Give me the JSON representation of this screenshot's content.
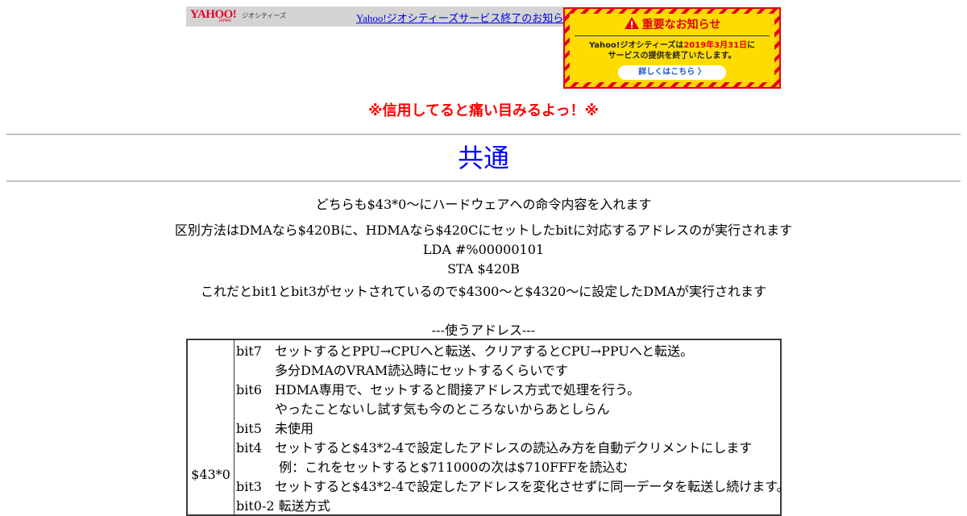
{
  "banner": {
    "logo": "YAHOO!",
    "logo_sub": "JAPAN",
    "service": "ジオシティーズ",
    "link_text": "Yahoo!ジオシティーズサービス終了のお知らせ",
    "notice_title": "重要なお知らせ",
    "notice_line1_a": "Yahoo!ジオシティーズは",
    "notice_line1_b": "2019年3月31日",
    "notice_line1_c": "に",
    "notice_line2": "サービスの提供を終了いたします。",
    "detail_button": "詳しくはこちら 〉",
    "colors": {
      "red": "#e2001a",
      "yellow": "#ffdc00",
      "link_blue": "#1a55c8"
    }
  },
  "page": {
    "warning": "※信用してると痛い目みるよっ！※",
    "heading": "共通",
    "intro1": "どちらも$43*0～にハードウェアへの命令内容を入れます",
    "intro2": "区別方法はDMAなら$420Bに、HDMAなら$420Cにセットしたbitに対応するアドレスのが実行されます",
    "code1": "LDA #%00000101",
    "code2": "STA $420B",
    "intro3": "これだとbit1とbit3がセットされているので$4300～と$4320～に設定したDMAが実行されます",
    "section_title": "---使うアドレス---",
    "colors": {
      "warning": "#ff0000",
      "heading": "#0000ff"
    }
  },
  "table": {
    "address": "$43*0",
    "lines": [
      "bit7　セットするとPPU→CPUへと転送、クリアするとCPU→PPUへと転送。",
      "　　　多分DMAのVRAM読込時にセットするくらいです",
      "bit6　HDMA専用で、セットすると間接アドレス方式で処理を行う。",
      "　　　やったことないし試す気も今のところないからあとしらん",
      "bit5　未使用",
      "bit4　セットすると$43*2-4で設定したアドレスの読込み方を自動デクリメントにします",
      "　　　 例：これをセットすると$711000の次は$710FFFを読込む",
      "bit3　セットすると$43*2-4で設定したアドレスを変化させずに同一データを転送し続けます。",
      "bit0-2  転送方式"
    ]
  }
}
